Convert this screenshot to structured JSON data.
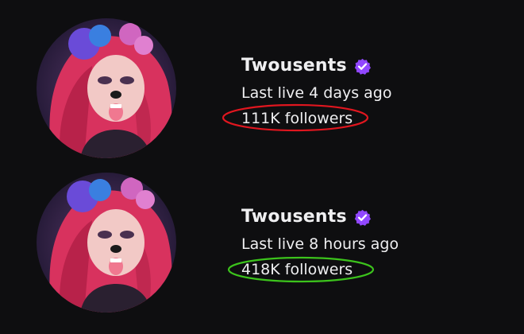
{
  "profiles": [
    {
      "channel_name": "Twousents",
      "last_live": "Last live 4 days ago",
      "followers": "111K followers",
      "highlight_color": "#e0161f"
    },
    {
      "channel_name": "Twousents",
      "last_live": "Last live 8 hours ago",
      "followers": "418K followers",
      "highlight_color": "#3cc31c"
    }
  ],
  "colors": {
    "background": "#0e0e10",
    "text": "#efeff1",
    "verified_badge": "#9147ff"
  },
  "icons": {
    "verified": "verified-badge-icon"
  }
}
